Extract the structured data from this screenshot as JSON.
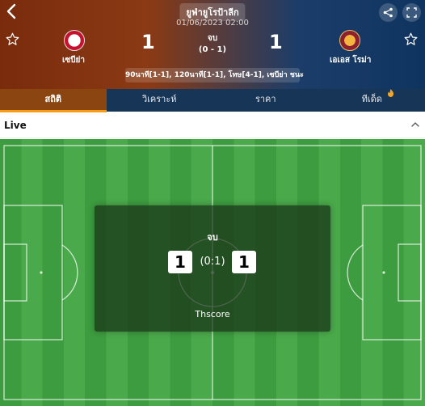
{
  "header": {
    "league": "ยูฟ่ายูโรป้าลีก",
    "datetime": "01/06/2023 02:00",
    "status": "จบ",
    "half_time": "(0 - 1)",
    "home_team": "เซบีย่า",
    "away_team": "เอเอส โรม่า",
    "home_score": "1",
    "away_score": "1",
    "result_detail": "90นาที[1-1], 120นาที[1-1], โทษ[4-1], เซบีย่า ชนะ",
    "icons": {
      "back": "chevron-left-icon",
      "share": "share-icon",
      "expand": "expand-icon",
      "favorite": "star-icon"
    }
  },
  "tabs": [
    {
      "label": "สถิติ",
      "active": true
    },
    {
      "label": "วิเคราะห์",
      "active": false
    },
    {
      "label": "ราคา",
      "active": false
    },
    {
      "label": "ทีเด็ด",
      "active": false
    }
  ],
  "live": {
    "label": "Live"
  },
  "overlay": {
    "status": "จบ",
    "home_score": "1",
    "half_time": "(0:1)",
    "away_score": "1",
    "brand": "Thscore"
  },
  "colors": {
    "header_left": "#7a2b0c",
    "header_right": "#0f3460",
    "tab_bar": "#163557",
    "tab_active": "#8a4510",
    "tab_underline": "#f59d1a",
    "pitch_dark": "#3d9c3f",
    "pitch_light": "#4aa94a"
  }
}
